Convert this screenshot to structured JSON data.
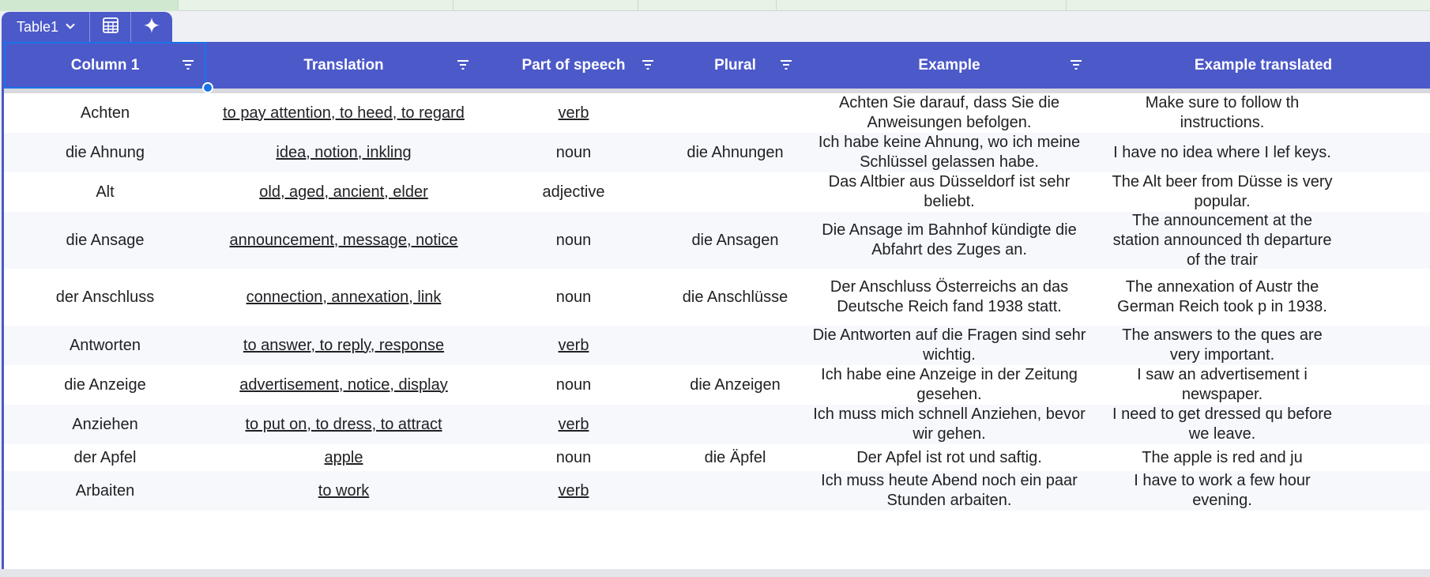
{
  "table": {
    "name": "Table1",
    "accent_color": "#4c59c9",
    "tabs": [
      {
        "kind": "name",
        "label": "Table1",
        "icon": "chevron-down-icon"
      },
      {
        "kind": "icon",
        "icon": "table-view-icon"
      },
      {
        "kind": "icon",
        "icon": "sparkle-icon"
      }
    ],
    "columns": [
      "Column 1",
      "Translation",
      "Part of speech",
      "Plural",
      "Example",
      "Example translated"
    ],
    "rows": [
      {
        "word": "Achten",
        "translation": "to pay attention, to heed, to regard",
        "pos": "verb",
        "pos_link": true,
        "plural": "",
        "example": "Achten Sie darauf, dass Sie die Anweisungen befolgen.",
        "example_translated": "Make sure to follow th instructions."
      },
      {
        "word": "die Ahnung",
        "translation": "idea, notion, inkling",
        "pos": "noun",
        "pos_link": false,
        "plural": "die Ahnungen",
        "example": "Ich habe keine Ahnung, wo ich meine Schlüssel gelassen habe.",
        "example_translated": "I have no idea where I lef keys."
      },
      {
        "word": "Alt",
        "translation": "old, aged, ancient, elder",
        "pos": "adjective",
        "pos_link": false,
        "plural": "",
        "example": "Das Altbier aus Düsseldorf ist sehr beliebt.",
        "example_translated": "The Alt beer from Düsse is very popular."
      },
      {
        "word": "die Ansage",
        "translation": "announcement, message, notice",
        "pos": "noun",
        "pos_link": false,
        "plural": "die Ansagen",
        "example": "Die Ansage im Bahnhof kündigte die Abfahrt des Zuges an.",
        "example_translated": "The announcement at the station announced th departure of the trair"
      },
      {
        "word": "der Anschluss",
        "translation": "connection, annexation, link",
        "pos": "noun",
        "pos_link": false,
        "plural": "die Anschlüsse",
        "example": "Der Anschluss Österreichs an das Deutsche Reich fand 1938 statt.",
        "example_translated": "The annexation of Austr the German Reich took p in 1938."
      },
      {
        "word": "Antworten",
        "translation": "to answer, to reply, response",
        "pos": "verb",
        "pos_link": true,
        "plural": "",
        "example": "Die Antworten auf die Fragen sind sehr wichtig.",
        "example_translated": "The answers to the ques are very important."
      },
      {
        "word": "die Anzeige",
        "translation": "advertisement, notice, display",
        "pos": "noun",
        "pos_link": false,
        "plural": "die Anzeigen",
        "example": "Ich habe eine Anzeige in der Zeitung gesehen.",
        "example_translated": "I saw an advertisement i newspaper."
      },
      {
        "word": "Anziehen",
        "translation": "to put on, to dress, to attract",
        "pos": "verb",
        "pos_link": true,
        "plural": "",
        "example": "Ich muss mich schnell Anziehen, bevor wir gehen.",
        "example_translated": "I need to get dressed qu before we leave."
      },
      {
        "word": "der Apfel",
        "translation": "apple",
        "pos": "noun",
        "pos_link": false,
        "plural": "die Äpfel",
        "example": "Der Apfel ist rot und saftig.",
        "example_translated": "The apple is red and ju"
      },
      {
        "word": "Arbaiten",
        "translation": "to work",
        "pos": "verb",
        "pos_link": true,
        "plural": "",
        "example": "Ich muss heute Abend noch ein paar Stunden arbaiten.",
        "example_translated": "I have to work a few hour evening."
      }
    ]
  }
}
